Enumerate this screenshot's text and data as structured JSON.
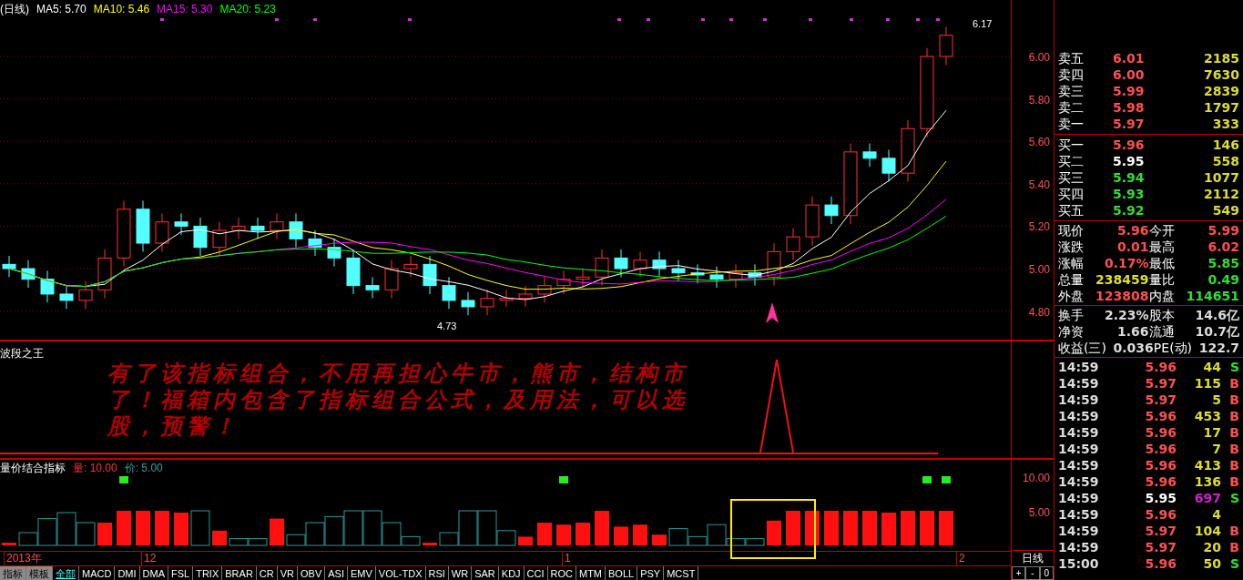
{
  "chart_header": {
    "title": "(日线)",
    "averages": [
      {
        "label": "MA5: 5.70",
        "color": "#ffffff"
      },
      {
        "label": "MA10: 5.46",
        "color": "#ffff00"
      },
      {
        "label": "MA15: 5.30",
        "color": "#ff00ff"
      },
      {
        "label": "MA20: 5.23",
        "color": "#00ff00"
      }
    ]
  },
  "price_axis": [
    "6.00",
    "5.80",
    "5.60",
    "5.40",
    "5.20",
    "5.00",
    "4.80"
  ],
  "chart_labels": {
    "high": "6.17",
    "low": "4.73"
  },
  "indicator_1": {
    "title": "波段之王",
    "message": "有了该指标组合，不用再担心牛市，熊市，结构市了！福箱内包含了指标组合公式，及用法，可以选股，预警！"
  },
  "indicator_2": {
    "title": "量价结合指标",
    "values": [
      {
        "label": "量: 10.00",
        "color": "#ff3333"
      },
      {
        "label": "价: 5.00",
        "color": "#3a9a9a"
      }
    ],
    "axis": [
      "10.00",
      "5.00"
    ]
  },
  "date_axis": [
    "2013年",
    "12",
    "1",
    "2"
  ],
  "period": "日线",
  "zoom_buttons": [
    "+",
    "-",
    "0"
  ],
  "tabs": [
    {
      "label": "指标",
      "kind": "mode",
      "selected": false
    },
    {
      "label": "模板",
      "kind": "mode",
      "selected": false
    },
    {
      "label": "全部",
      "kind": "indicator",
      "selected": true
    },
    {
      "label": "MACD",
      "kind": "indicator",
      "selected": false
    },
    {
      "label": "DMI",
      "kind": "indicator",
      "selected": false
    },
    {
      "label": "DMA",
      "kind": "indicator",
      "selected": false
    },
    {
      "label": "FSL",
      "kind": "indicator",
      "selected": false
    },
    {
      "label": "TRIX",
      "kind": "indicator",
      "selected": false
    },
    {
      "label": "BRAR",
      "kind": "indicator",
      "selected": false
    },
    {
      "label": "CR",
      "kind": "indicator",
      "selected": false
    },
    {
      "label": "VR",
      "kind": "indicator",
      "selected": false
    },
    {
      "label": "OBV",
      "kind": "indicator",
      "selected": false
    },
    {
      "label": "ASI",
      "kind": "indicator",
      "selected": false
    },
    {
      "label": "EMV",
      "kind": "indicator",
      "selected": false
    },
    {
      "label": "VOL-TDX",
      "kind": "indicator",
      "selected": false
    },
    {
      "label": "RSI",
      "kind": "indicator",
      "selected": false
    },
    {
      "label": "WR",
      "kind": "indicator",
      "selected": false
    },
    {
      "label": "SAR",
      "kind": "indicator",
      "selected": false
    },
    {
      "label": "KDJ",
      "kind": "indicator",
      "selected": false
    },
    {
      "label": "CCI",
      "kind": "indicator",
      "selected": false
    },
    {
      "label": "ROC",
      "kind": "indicator",
      "selected": false
    },
    {
      "label": "MTM",
      "kind": "indicator",
      "selected": false
    },
    {
      "label": "BOLL",
      "kind": "indicator",
      "selected": false
    },
    {
      "label": "PSY",
      "kind": "indicator",
      "selected": false
    },
    {
      "label": "MCST",
      "kind": "indicator",
      "selected": false
    }
  ],
  "sell_orders": [
    {
      "label": "卖五",
      "price": "6.01",
      "volume": "2185",
      "color": "#ff5050"
    },
    {
      "label": "卖四",
      "price": "6.00",
      "volume": "7630",
      "color": "#ff5050"
    },
    {
      "label": "卖三",
      "price": "5.99",
      "volume": "2839",
      "color": "#ff5050"
    },
    {
      "label": "卖二",
      "price": "5.98",
      "volume": "1797",
      "color": "#ff5050"
    },
    {
      "label": "卖一",
      "price": "5.97",
      "volume": "333",
      "color": "#ff5050"
    }
  ],
  "buy_orders": [
    {
      "label": "买一",
      "price": "5.96",
      "volume": "146",
      "color": "#ff5050"
    },
    {
      "label": "买二",
      "price": "5.95",
      "volume": "558",
      "color": "#ffffff"
    },
    {
      "label": "买三",
      "price": "5.94",
      "volume": "1077",
      "color": "#33dd33"
    },
    {
      "label": "买四",
      "price": "5.93",
      "volume": "2112",
      "color": "#33dd33"
    },
    {
      "label": "买五",
      "price": "5.92",
      "volume": "549",
      "color": "#33dd33"
    }
  ],
  "quote": [
    {
      "label": "现价",
      "value": "5.96",
      "color": "#ff5050"
    },
    {
      "label": "今开",
      "value": "5.99",
      "color": "#ff5050"
    },
    {
      "label": "涨跌",
      "value": "0.01",
      "color": "#ff5050"
    },
    {
      "label": "最高",
      "value": "6.02",
      "color": "#ff5050"
    },
    {
      "label": "涨幅",
      "value": "0.17%",
      "color": "#ff5050"
    },
    {
      "label": "最低",
      "value": "5.85",
      "color": "#33dd33"
    },
    {
      "label": "总量",
      "value": "238459",
      "color": "#dddd33"
    },
    {
      "label": "量比",
      "value": "0.49",
      "color": "#33dd33"
    },
    {
      "label": "外盘",
      "value": "123808",
      "color": "#ff5050"
    },
    {
      "label": "内盘",
      "value": "114651",
      "color": "#33dd33"
    }
  ],
  "fundamentals": [
    {
      "label": "换手",
      "value": "2.23%"
    },
    {
      "label": "股本",
      "value": "14.6亿"
    },
    {
      "label": "净资",
      "value": "1.66"
    },
    {
      "label": "流通",
      "value": "10.7亿"
    },
    {
      "label": "收益(三)",
      "value": "0.036"
    },
    {
      "label": "PE(动)",
      "value": "122.7"
    }
  ],
  "trades": [
    {
      "time": "14:59",
      "price": "5.96",
      "volume": "44",
      "side": "S",
      "color": "#ff5050",
      "large": false
    },
    {
      "time": "14:59",
      "price": "5.97",
      "volume": "115",
      "side": "B",
      "color": "#ff5050",
      "large": false
    },
    {
      "time": "14:59",
      "price": "5.97",
      "volume": "5",
      "side": "B",
      "color": "#ff5050",
      "large": false
    },
    {
      "time": "14:59",
      "price": "5.96",
      "volume": "453",
      "side": "B",
      "color": "#ff5050",
      "large": false
    },
    {
      "time": "14:59",
      "price": "5.96",
      "volume": "17",
      "side": "B",
      "color": "#ff5050",
      "large": false
    },
    {
      "time": "14:59",
      "price": "5.96",
      "volume": "7",
      "side": "B",
      "color": "#ff5050",
      "large": false
    },
    {
      "time": "14:59",
      "price": "5.96",
      "volume": "413",
      "side": "B",
      "color": "#ff5050",
      "large": false
    },
    {
      "time": "14:59",
      "price": "5.96",
      "volume": "136",
      "side": "B",
      "color": "#ff5050",
      "large": false
    },
    {
      "time": "14:59",
      "price": "5.95",
      "volume": "697",
      "side": "S",
      "color": "#ffffff",
      "large": true
    },
    {
      "time": "14:59",
      "price": "5.96",
      "volume": "4",
      "color": "#ff5050",
      "large": false
    },
    {
      "time": "14:59",
      "price": "5.97",
      "volume": "104",
      "side": "B",
      "color": "#ff5050",
      "large": false
    },
    {
      "time": "14:59",
      "price": "5.97",
      "volume": "20",
      "side": "B",
      "color": "#ff5050",
      "large": false
    },
    {
      "time": "15:00",
      "price": "5.96",
      "volume": "50",
      "side": "S",
      "color": "#ff5050",
      "large": false
    }
  ]
}
